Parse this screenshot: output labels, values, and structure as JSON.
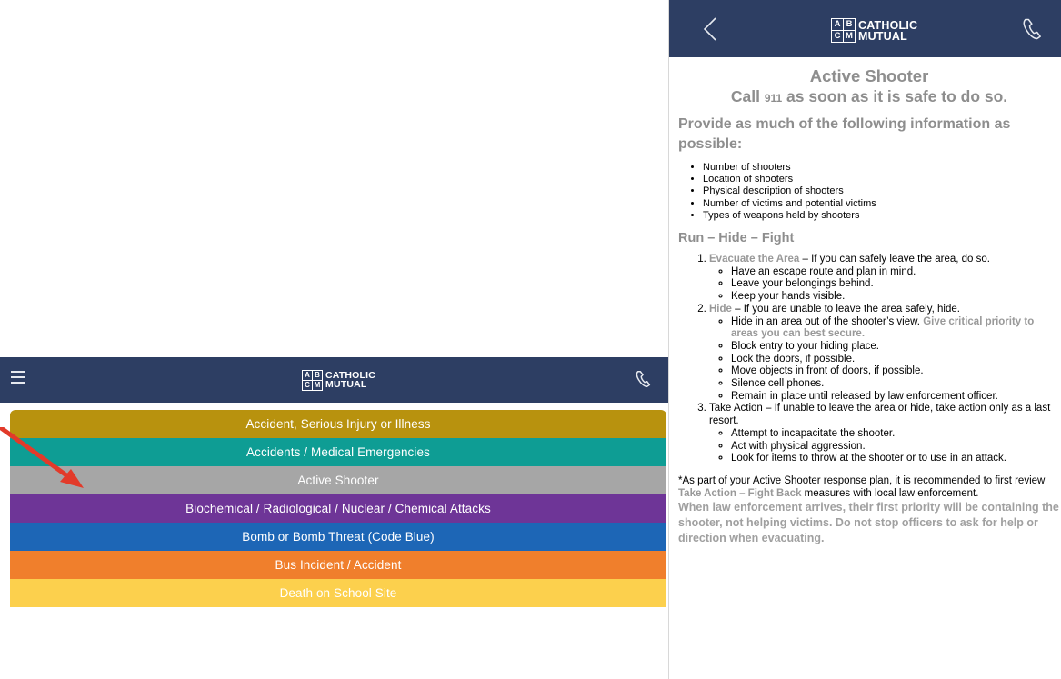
{
  "left_app": {
    "logo_line1": "CATHOLIC",
    "logo_line2": "MUTUAL",
    "categories": [
      {
        "label": "Accident, Serious Injury or Illness",
        "color": "#b8920e"
      },
      {
        "label": "Accidents / Medical Emergencies",
        "color": "#0e9d94"
      },
      {
        "label": "Active Shooter",
        "color": "#a6a6a6"
      },
      {
        "label": "Biochemical / Radiological / Nuclear / Chemical Attacks",
        "color": "#6e3597"
      },
      {
        "label": "Bomb or Bomb Threat (Code Blue)",
        "color": "#1d66b6"
      },
      {
        "label": "Bus Incident / Accident",
        "color": "#f07f2c"
      },
      {
        "label": "Death on School Site",
        "color": "#fcd04d"
      }
    ],
    "arrow_color": "#e23a2a"
  },
  "right_app": {
    "logo_line1": "CATHOLIC",
    "logo_line2": "MUTUAL",
    "title": "Active Shooter",
    "subtitle_pre": "Call ",
    "subtitle_num": "911",
    "subtitle_post": " as soon as it is safe to do so.",
    "lead": "Provide as much of the following information as possible:",
    "info_items": [
      "Number of shooters",
      "Location of shooters",
      "Physical description of shooters",
      "Number of victims and potential victims",
      "Types of weapons held by shooters"
    ],
    "section": "Run – Hide – Fight",
    "step1": {
      "label": "Evacuate the Area",
      "text": " – If you can safely leave the area, do so.",
      "subs": [
        "Have an escape route and plan in mind.",
        "Leave your belongings behind.",
        "Keep your hands visible."
      ]
    },
    "step2": {
      "label": "Hide",
      "text": " – If you are unable to leave the area safely, hide.",
      "sub1_text": "Hide in an area out of the shooter’s view. ",
      "sub1_emph": "Give critical priority to areas you can best secure.",
      "subs": [
        "Block entry to your hiding place.",
        "Lock the doors, if possible.",
        "Move objects in front of doors, if possible.",
        "Silence cell phones.",
        "Remain in place until released by law enforcement officer."
      ]
    },
    "step3": {
      "text": "Take Action – If unable to leave the area or hide, take action only as a last resort.",
      "subs": [
        "Attempt to incapacitate the shooter.",
        "Act with physical aggression.",
        "Look for items to throw at the shooter or to use in an attack."
      ]
    },
    "note_pre": "*As part of your Active Shooter response plan, it is recommended to first review ",
    "note_emph": "Take Action – Fight Back",
    "note_post": " measures with local law enforcement.",
    "final": "When law enforcement arrives, their first priority will be containing the shooter, not helping victims. Do not stop officers to ask for help or direction when evacuating."
  }
}
